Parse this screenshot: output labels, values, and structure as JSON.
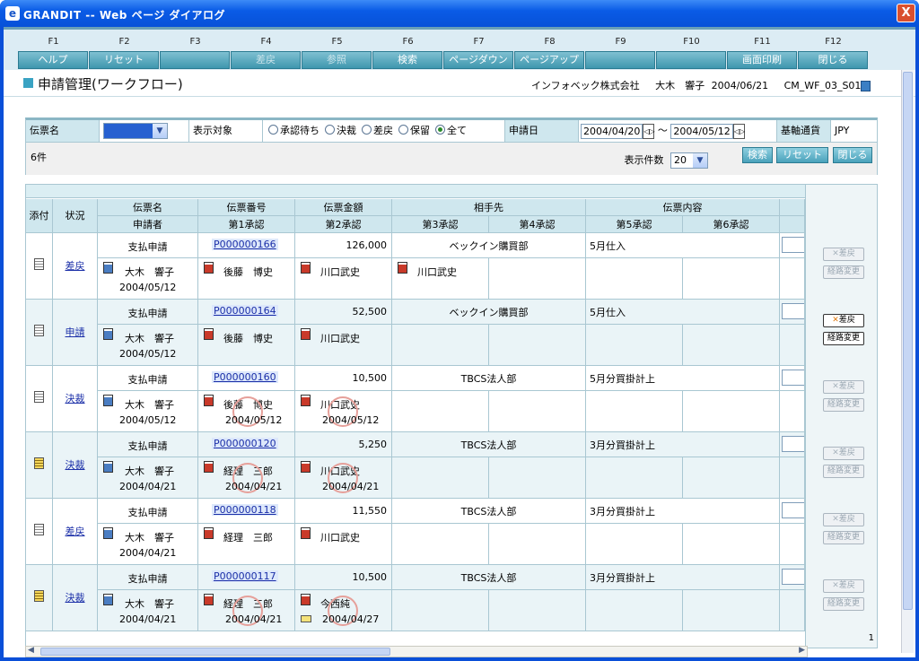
{
  "window": {
    "title": "GRANDIT -- Web ページ ダイアログ",
    "close_glyph": "X",
    "app_glyph": "e"
  },
  "fkeys": [
    {
      "key": "F1",
      "label": "ヘルプ",
      "enabled": true
    },
    {
      "key": "F2",
      "label": "リセット",
      "enabled": true
    },
    {
      "key": "F3",
      "label": "",
      "enabled": false
    },
    {
      "key": "F4",
      "label": "差戻",
      "enabled": false
    },
    {
      "key": "F5",
      "label": "参照",
      "enabled": false
    },
    {
      "key": "F6",
      "label": "検索",
      "enabled": true
    },
    {
      "key": "F7",
      "label": "ページダウン",
      "enabled": true
    },
    {
      "key": "F8",
      "label": "ページアップ",
      "enabled": true
    },
    {
      "key": "F9",
      "label": "",
      "enabled": false
    },
    {
      "key": "F10",
      "label": "",
      "enabled": false
    },
    {
      "key": "F11",
      "label": "画面印刷",
      "enabled": true
    },
    {
      "key": "F12",
      "label": "閉じる",
      "enabled": true
    }
  ],
  "header": {
    "title": "申請管理(ワークフロー)",
    "company": "インフォベック株式会社",
    "user": "大木　響子",
    "date": "2004/06/21",
    "screen_id": "CM_WF_03_S01"
  },
  "filter": {
    "slip_name_label": "伝票名",
    "display_label": "表示対象",
    "radios": [
      "承認待ち",
      "決裁",
      "差戻",
      "保留",
      "全て"
    ],
    "radio_selected": "全て",
    "apply_date_label": "申請日",
    "date_from": "2004/04/20",
    "date_sep": "～",
    "date_to": "2004/05/12",
    "currency_label": "基軸通貨",
    "currency": "JPY",
    "count": "6件",
    "per_page_label": "表示件数",
    "per_page": "20",
    "search_btn": "検索",
    "reset_btn": "リセット",
    "close_btn": "閉じる"
  },
  "grid": {
    "page": "1",
    "headers": {
      "attach": "添付",
      "status": "状況",
      "slip_name": "伝票名",
      "slip_no": "伝票番号",
      "amount": "伝票金額",
      "partner": "相手先",
      "content": "伝票内容",
      "applicant": "申請者",
      "a1": "第1承認",
      "a2": "第2承認",
      "a3": "第3承認",
      "a4": "第4承認",
      "a5": "第5承認",
      "a6": "第6承認"
    },
    "rows": [
      {
        "status": "差戻",
        "name": "支払申請",
        "no": "P000000166",
        "amount": "126,000",
        "partner": "ベックイン購買部",
        "content": "5月仕入",
        "applicant": "大木　響子",
        "apply_date": "2004/05/12",
        "a1": "後藤　博史",
        "a1_date": "",
        "a2": "川口武史",
        "a2_date": "",
        "a3": "川口武史",
        "doc": "white",
        "btn_active": false
      },
      {
        "status": "申請",
        "name": "支払申請",
        "no": "P000000164",
        "amount": "52,500",
        "partner": "ベックイン購買部",
        "content": "5月仕入",
        "applicant": "大木　響子",
        "apply_date": "2004/05/12",
        "a1": "後藤　博史",
        "a1_date": "",
        "a2": "川口武史",
        "a2_date": "",
        "a3": "",
        "doc": "white",
        "btn_active": true
      },
      {
        "status": "決裁",
        "name": "支払申請",
        "no": "P000000160",
        "amount": "10,500",
        "partner": "TBCS法人部",
        "content": "5月分買掛計上",
        "applicant": "大木　響子",
        "apply_date": "2004/05/12",
        "a1": "後藤　博史",
        "a1_date": "2004/05/12",
        "a2": "川口武史",
        "a2_date": "2004/05/12",
        "a3": "",
        "doc": "white",
        "btn_active": false
      },
      {
        "status": "決裁",
        "name": "支払申請",
        "no": "P000000120",
        "amount": "5,250",
        "partner": "TBCS法人部",
        "content": "3月分買掛計上",
        "applicant": "大木　響子",
        "apply_date": "2004/04/21",
        "a1": "経理　三郎",
        "a1_date": "2004/04/21",
        "a2": "川口武史",
        "a2_date": "2004/04/21",
        "a3": "",
        "doc": "yellow",
        "btn_active": false
      },
      {
        "status": "差戻",
        "name": "支払申請",
        "no": "P000000118",
        "amount": "11,550",
        "partner": "TBCS法人部",
        "content": "3月分買掛計上",
        "applicant": "大木　響子",
        "apply_date": "2004/04/21",
        "a1": "経理　三郎",
        "a1_date": "",
        "a2": "川口武史",
        "a2_date": "",
        "a3": "",
        "doc": "white",
        "btn_active": false
      },
      {
        "status": "決裁",
        "name": "支払申請",
        "no": "P000000117",
        "amount": "10,500",
        "partner": "TBCS法人部",
        "content": "3月分買掛計上",
        "applicant": "大木　響子",
        "apply_date": "2004/04/21",
        "a1": "経理　三郎",
        "a1_date": "2004/04/21",
        "a2": "今西純",
        "a2_date": "2004/04/27",
        "a3": "",
        "doc": "yellow",
        "btn_active": false
      }
    ],
    "btn_return": "差戻",
    "btn_route": "経路変更"
  },
  "colors": {
    "accent": "#3aa3c3",
    "titlebar": "#0a5be6",
    "header_cell": "#cfe7ee",
    "stamp": "#e6a09a",
    "link": "#1b2fa8"
  }
}
